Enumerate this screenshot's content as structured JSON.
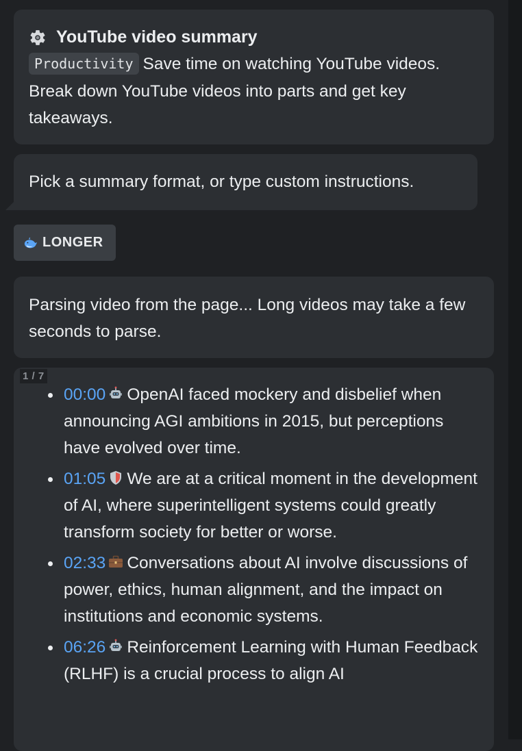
{
  "intro": {
    "title": "YouTube video summary",
    "tag": "Productivity",
    "description": "Save time on watching YouTube videos. Break down YouTube videos into parts and get key takeaways."
  },
  "prompt": {
    "text": "Pick a summary format, or type custom instructions."
  },
  "chip": {
    "label": "LONGER",
    "icon": "whale-icon"
  },
  "parsing": {
    "text": "Parsing video from the page... Long videos may take a few seconds to parse."
  },
  "result": {
    "counter": "1 / 7",
    "items": [
      {
        "time": "00:00",
        "icon": "robot-icon",
        "text": "OpenAI faced mockery and disbelief when announcing AGI ambitions in 2015, but perceptions have evolved over time."
      },
      {
        "time": "01:05",
        "icon": "shield-icon",
        "text": "We are at a critical moment in the development of AI, where superintelligent systems could greatly transform society for better or worse."
      },
      {
        "time": "02:33",
        "icon": "briefcase-icon",
        "text": "Conversations about AI involve discussions of power, ethics, human alignment, and the impact on institutions and economic systems."
      },
      {
        "time": "06:26",
        "icon": "robot-icon",
        "text": "Reinforcement Learning with Human Feedback (RLHF) is a crucial process to align AI"
      }
    ]
  }
}
